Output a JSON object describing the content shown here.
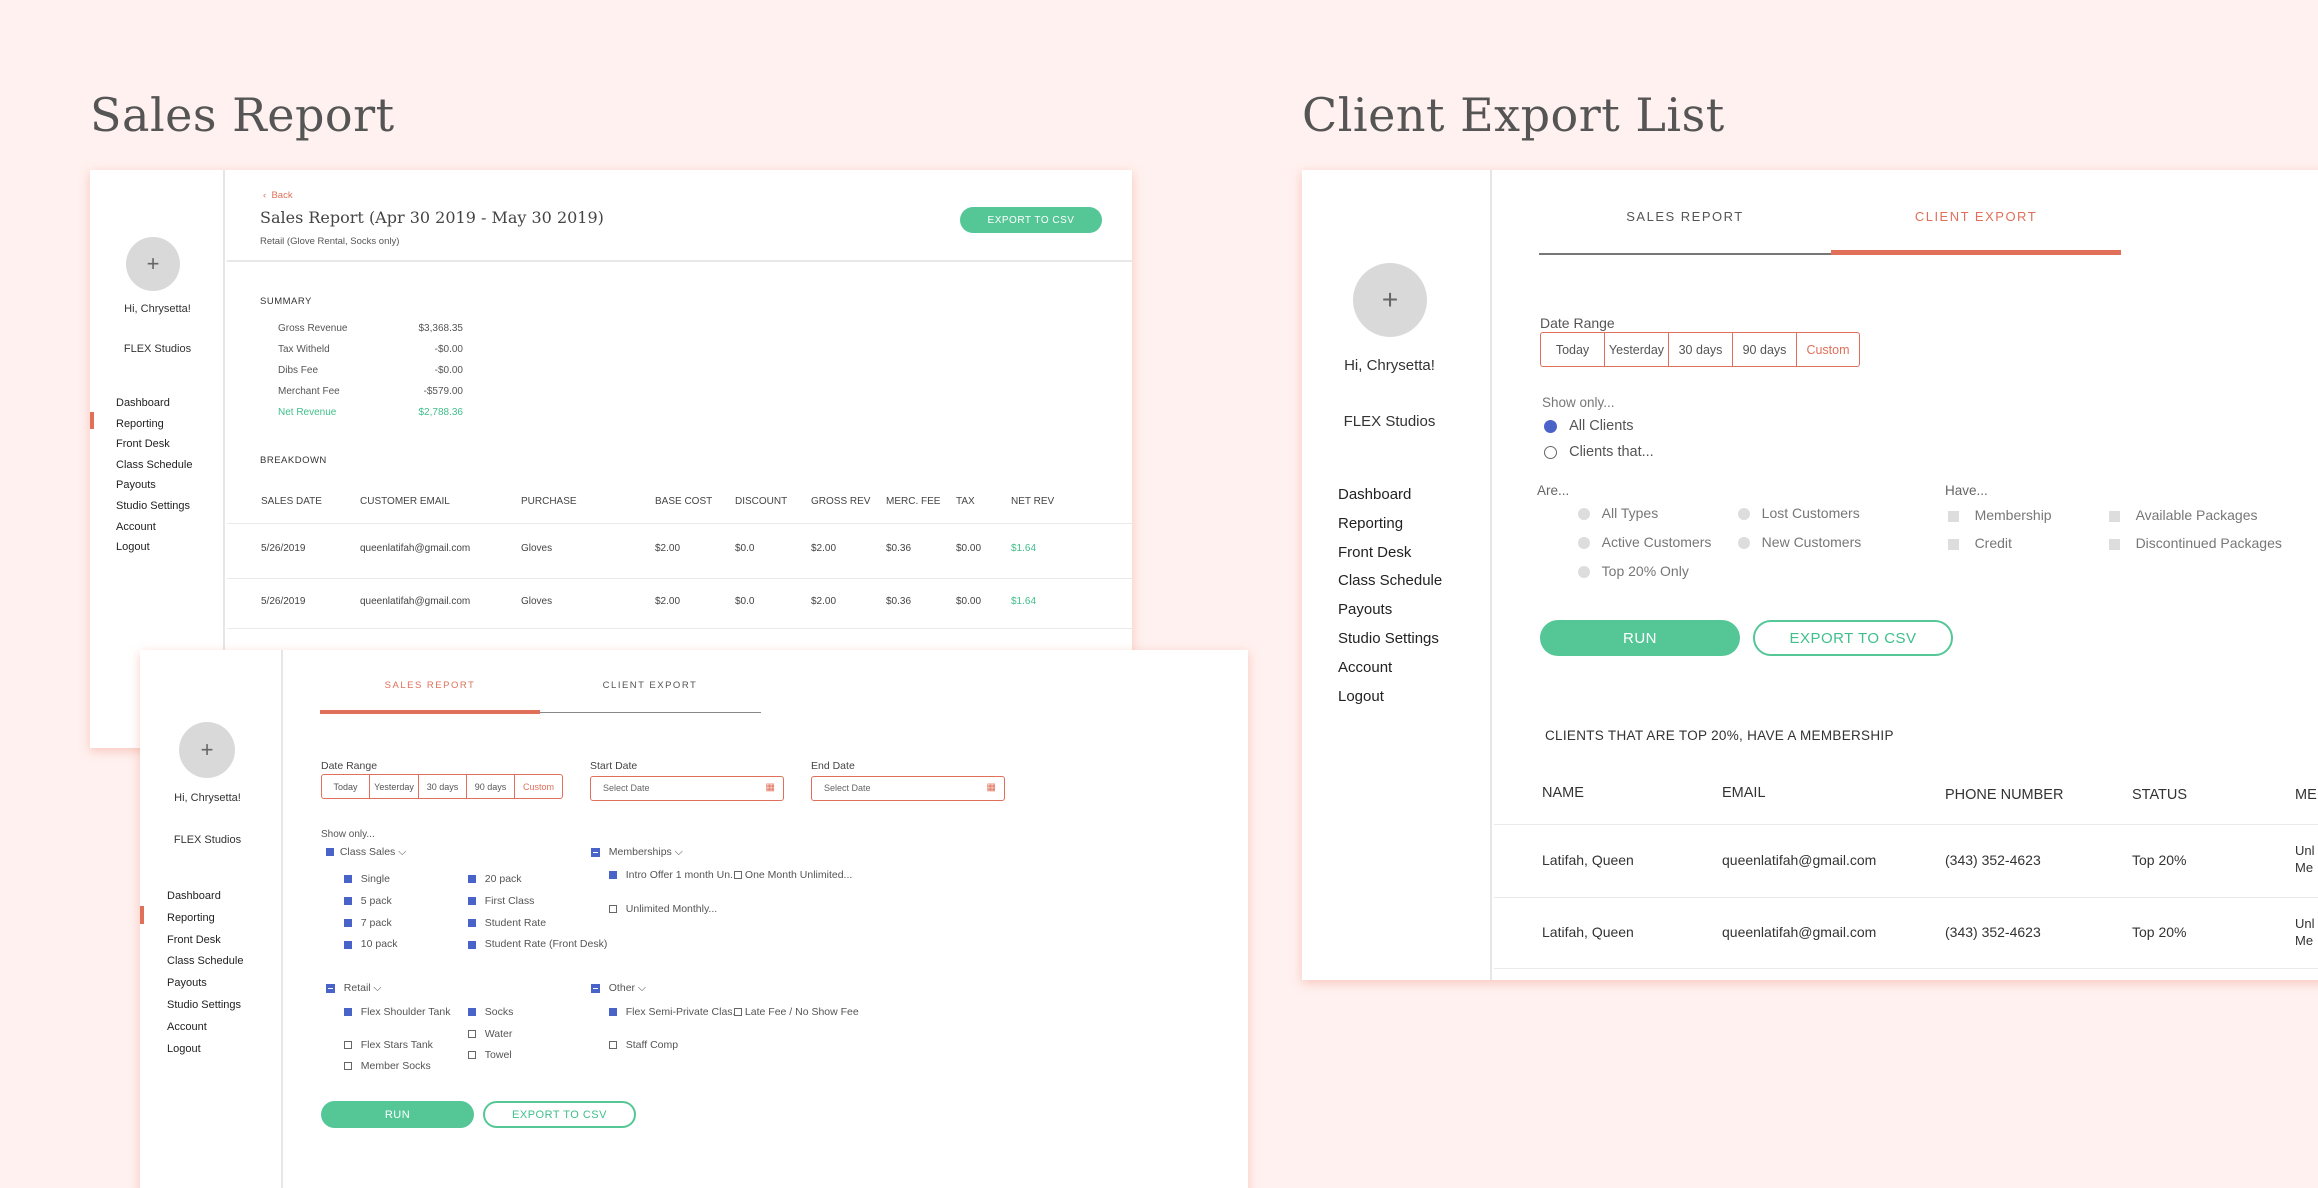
{
  "headings": {
    "left": "Sales Report",
    "right": "Client Export List"
  },
  "sidebar": {
    "greeting": "Hi, Chrysetta!",
    "studio": "FLEX Studios",
    "items": [
      "Dashboard",
      "Reporting",
      "Front Desk",
      "Class Schedule",
      "Payouts",
      "Studio Settings",
      "Account",
      "Logout"
    ],
    "active_index": 1,
    "avatar_symbol": "+"
  },
  "sales_card": {
    "back": "Back",
    "title": "Sales Report (Apr 30 2019 - May 30 2019)",
    "subtitle": "Retail (Glove Rental, Socks only)",
    "export_button": "EXPORT TO CSV",
    "summary_label": "SUMMARY",
    "summary": [
      {
        "label": "Gross Revenue",
        "value": "$3,368.35"
      },
      {
        "label": "Tax Witheld",
        "value": "-$0.00"
      },
      {
        "label": "Dibs Fee",
        "value": "-$0.00"
      },
      {
        "label": "Merchant Fee",
        "value": "-$579.00"
      },
      {
        "label": "Net Revenue",
        "value": "$2,788.36"
      }
    ],
    "breakdown_label": "BREAKDOWN",
    "columns": [
      "SALES DATE",
      "CUSTOMER EMAIL",
      "PURCHASE",
      "BASE COST",
      "DISCOUNT",
      "GROSS REV",
      "MERC. FEE",
      "TAX",
      "NET REV"
    ],
    "rows": [
      [
        "5/26/2019",
        "queenlatifah@gmail.com",
        "Gloves",
        "$2.00",
        "$0.0",
        "$2.00",
        "$0.36",
        "$0.00",
        "$1.64"
      ],
      [
        "5/26/2019",
        "queenlatifah@gmail.com",
        "Gloves",
        "$2.00",
        "$0.0",
        "$2.00",
        "$0.36",
        "$0.00",
        "$1.64"
      ]
    ]
  },
  "filter_card": {
    "tabs": [
      "SALES REPORT",
      "CLIENT EXPORT"
    ],
    "date_range_label": "Date Range",
    "ranges": [
      "Today",
      "Yesterday",
      "30 days",
      "90 days",
      "Custom"
    ],
    "start_label": "Start Date",
    "end_label": "End Date",
    "date_placeholder": "Select Date",
    "show_only": "Show only...",
    "groups": {
      "class_sales": "Class Sales",
      "memberships": "Memberships",
      "retail": "Retail",
      "other": "Other"
    },
    "class_sales_col1": [
      "Single",
      "5 pack",
      "7 pack",
      "10 pack"
    ],
    "class_sales_col2": [
      "20 pack",
      "First Class",
      "Student Rate",
      "Student Rate (Front Desk)"
    ],
    "memberships_items": [
      "Intro Offer 1 month Un...",
      "One Month Unlimited...",
      "Unlimited Monthly..."
    ],
    "retail_col1": [
      "Flex Shoulder  Tank",
      "Flex Stars Tank",
      "Member Socks"
    ],
    "retail_col2": [
      "Socks",
      "Water",
      "Towel"
    ],
    "other_items": [
      "Flex Semi-Private Clas...",
      "Late Fee / No Show Fee",
      "Staff Comp"
    ],
    "run": "RUN",
    "export": "EXPORT TO CSV"
  },
  "client_card": {
    "tabs": [
      "SALES REPORT",
      "CLIENT EXPORT"
    ],
    "date_range_label": "Date Range",
    "ranges": [
      "Today",
      "Yesterday",
      "30 days",
      "90 days",
      "Custom"
    ],
    "show_only": "Show only...",
    "radio_all": "All Clients",
    "radio_that": "Clients that...",
    "are_label": "Are...",
    "are_items": [
      "All Types",
      "Lost Customers",
      "Active Customers",
      "New Customers",
      "Top 20% Only"
    ],
    "have_label": "Have...",
    "have_items": [
      "Membership",
      "Available Packages",
      "Credit",
      "Discontinued Packages"
    ],
    "run": "RUN",
    "export": "EXPORT TO CSV",
    "result_title": "CLIENTS THAT ARE TOP 20%, HAVE A MEMBERSHIP",
    "columns": [
      "NAME",
      "EMAIL",
      "PHONE NUMBER",
      "STATUS",
      "ME"
    ],
    "rows": [
      [
        "Latifah, Queen",
        "queenlatifah@gmail.com",
        "(343) 352-4623",
        "Top 20%",
        "Unl",
        "Me"
      ],
      [
        "Latifah, Queen",
        "queenlatifah@gmail.com",
        "(343) 352-4623",
        "Top 20%",
        "Unl",
        "Me"
      ]
    ]
  },
  "colors": {
    "accent": "#e0705a",
    "green": "#55c797",
    "checkbox": "#4a63c9",
    "background": "#fff1ef"
  }
}
